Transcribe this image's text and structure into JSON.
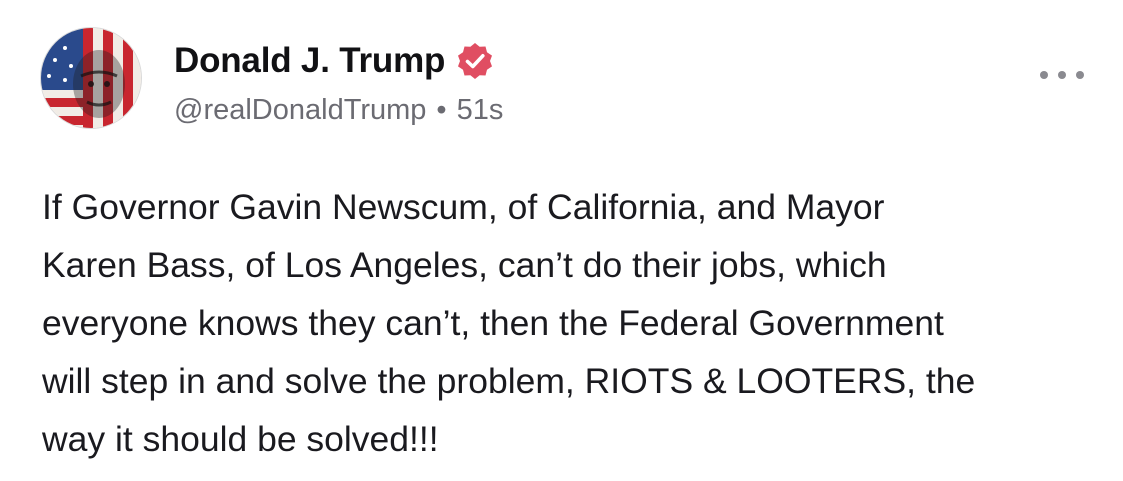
{
  "post": {
    "author": {
      "display_name": "Donald J. Trump",
      "handle": "@realDonaldTrump",
      "verified": true,
      "avatar_icon": "avatar-flag-portrait-icon"
    },
    "timestamp": "51s",
    "separator": "•",
    "more_icon": "more-options-icon",
    "text_lines": [
      "If Governor Gavin Newscum, of California, and Mayor",
      "Karen Bass, of Los Angeles, can’t do their jobs, which",
      "everyone knows they can’t, then the Federal Government",
      "will step in and solve the problem, RIOTS & LOOTERS, the",
      "way it should be solved!!!"
    ]
  },
  "colors": {
    "background": "#ffffff",
    "name_text": "#111114",
    "meta_text": "#6b6b72",
    "body_text": "#1a1a1f",
    "verified_badge": "#e04e62",
    "flag_red": "#c8262f",
    "flag_blue": "#2a4a8c"
  }
}
